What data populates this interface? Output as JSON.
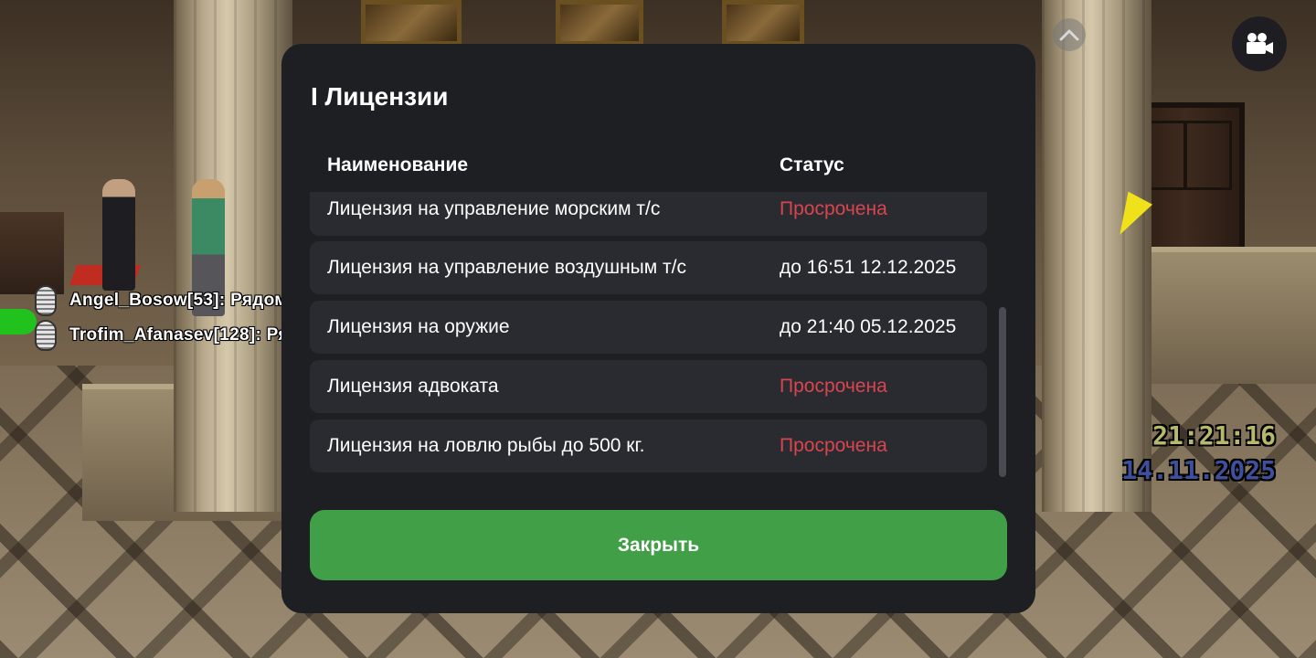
{
  "chat": [
    {
      "text": "Angel_Bosow[53]: Рядом"
    },
    {
      "text": "Trofim_Afanasev[128]: Ря"
    }
  ],
  "hud": {
    "time": "21:21:16",
    "date": "14.11.2025",
    "camera_icon": "video-camera-icon",
    "chevron_icon": "chevron-up-icon"
  },
  "modal": {
    "title": "I Лицензии",
    "columns": {
      "name": "Наименование",
      "status": "Статус"
    },
    "rows": [
      {
        "name": "Лицензия на управление морским т/с",
        "status": "Просрочена",
        "expired": true
      },
      {
        "name": "Лицензия на управление воздушным т/с",
        "status": "до 16:51 12.12.2025",
        "expired": false
      },
      {
        "name": "Лицензия на оружие",
        "status": "до 21:40 05.12.2025",
        "expired": false
      },
      {
        "name": "Лицензия адвоката",
        "status": "Просрочена",
        "expired": true
      },
      {
        "name": "Лицензия на ловлю рыбы до 500 кг.",
        "status": "Просрочена",
        "expired": true
      }
    ],
    "close_label": "Закрыть"
  },
  "colors": {
    "modal_bg": "#1e1f23",
    "row_bg": "#2a2b30",
    "expired": "#d9454f",
    "close_button": "#41a047"
  }
}
